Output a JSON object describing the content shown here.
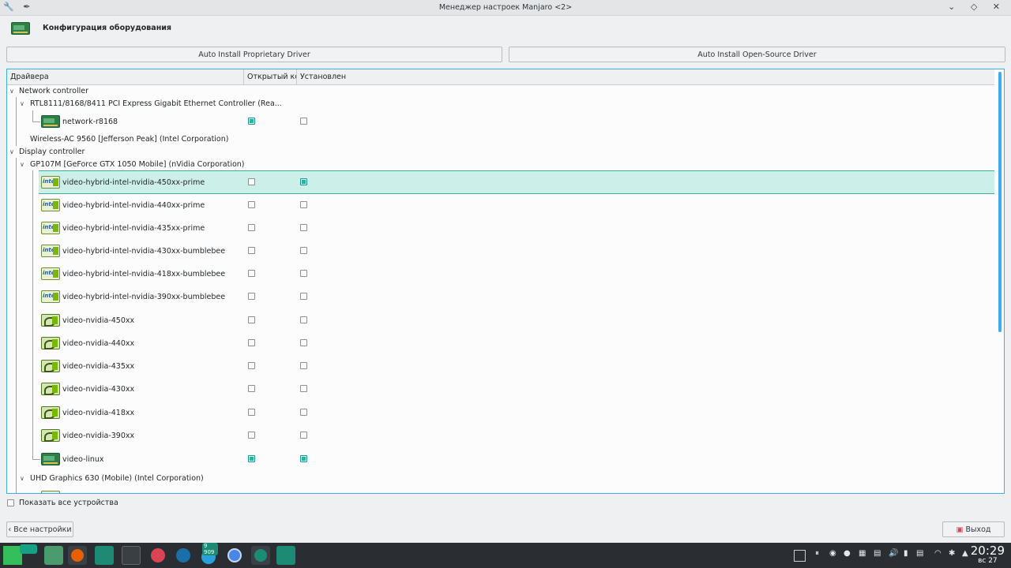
{
  "window": {
    "title": "Менеджер настроек Manjaro <2>",
    "left_icons": "🔧 ✒",
    "controls": "⌄ ◇ ✕"
  },
  "header": {
    "title": "Конфигурация оборудования",
    "icon": "hardware-card-icon"
  },
  "buttons": {
    "auto_proprietary": "Auto Install Proprietary Driver",
    "auto_open_source": "Auto Install Open-Source Driver",
    "back": "Все настройки",
    "exit": "Выход"
  },
  "table": {
    "columns": [
      "Драйвера",
      "Открытый код",
      "Установлен"
    ],
    "groups": [
      {
        "label": "Network controller"
      },
      {
        "label": "RTL8111/8168/8411 PCI Express Gigabit Ethernet Controller (Rea..."
      },
      {
        "label": "Wireless-AC 9560 [Jefferson Peak] (Intel Corporation)"
      },
      {
        "label": "Display controller"
      },
      {
        "label": "GP107M [GeForce GTX 1050 Mobile] (nVidia Corporation)"
      },
      {
        "label": "UHD Graphics 630 (Mobile) (Intel Corporation)"
      }
    ],
    "drivers": [
      {
        "name": "network-r8168",
        "icon": "network-card-icon",
        "open_source": true,
        "installed": false
      },
      {
        "name": "video-hybrid-intel-nvidia-450xx-prime",
        "icon": "intel-nvidia-icon",
        "open_source": false,
        "installed": true,
        "selected": true
      },
      {
        "name": "video-hybrid-intel-nvidia-440xx-prime",
        "icon": "intel-nvidia-icon",
        "open_source": false,
        "installed": false
      },
      {
        "name": "video-hybrid-intel-nvidia-435xx-prime",
        "icon": "intel-nvidia-icon",
        "open_source": false,
        "installed": false
      },
      {
        "name": "video-hybrid-intel-nvidia-430xx-bumblebee",
        "icon": "intel-nvidia-icon",
        "open_source": false,
        "installed": false
      },
      {
        "name": "video-hybrid-intel-nvidia-418xx-bumblebee",
        "icon": "intel-nvidia-icon",
        "open_source": false,
        "installed": false
      },
      {
        "name": "video-hybrid-intel-nvidia-390xx-bumblebee",
        "icon": "intel-nvidia-icon",
        "open_source": false,
        "installed": false
      },
      {
        "name": "video-nvidia-450xx",
        "icon": "nvidia-icon",
        "open_source": false,
        "installed": false
      },
      {
        "name": "video-nvidia-440xx",
        "icon": "nvidia-icon",
        "open_source": false,
        "installed": false
      },
      {
        "name": "video-nvidia-435xx",
        "icon": "nvidia-icon",
        "open_source": false,
        "installed": false
      },
      {
        "name": "video-nvidia-430xx",
        "icon": "nvidia-icon",
        "open_source": false,
        "installed": false
      },
      {
        "name": "video-nvidia-418xx",
        "icon": "nvidia-icon",
        "open_source": false,
        "installed": false
      },
      {
        "name": "video-nvidia-390xx",
        "icon": "nvidia-icon",
        "open_source": false,
        "installed": false
      },
      {
        "name": "video-linux",
        "icon": "video-card-icon",
        "open_source": true,
        "installed": true
      }
    ]
  },
  "show_all_devices": {
    "label": "Показать все устройства",
    "checked": false
  },
  "taskbar": {
    "badge": "9 909",
    "clock": {
      "time": "20:29",
      "date": "вс 27"
    }
  },
  "colors": {
    "accent": "#3daee9",
    "selection": "#cdefe9",
    "check": "#1abc9c",
    "taskbar": "#2a2e32"
  }
}
